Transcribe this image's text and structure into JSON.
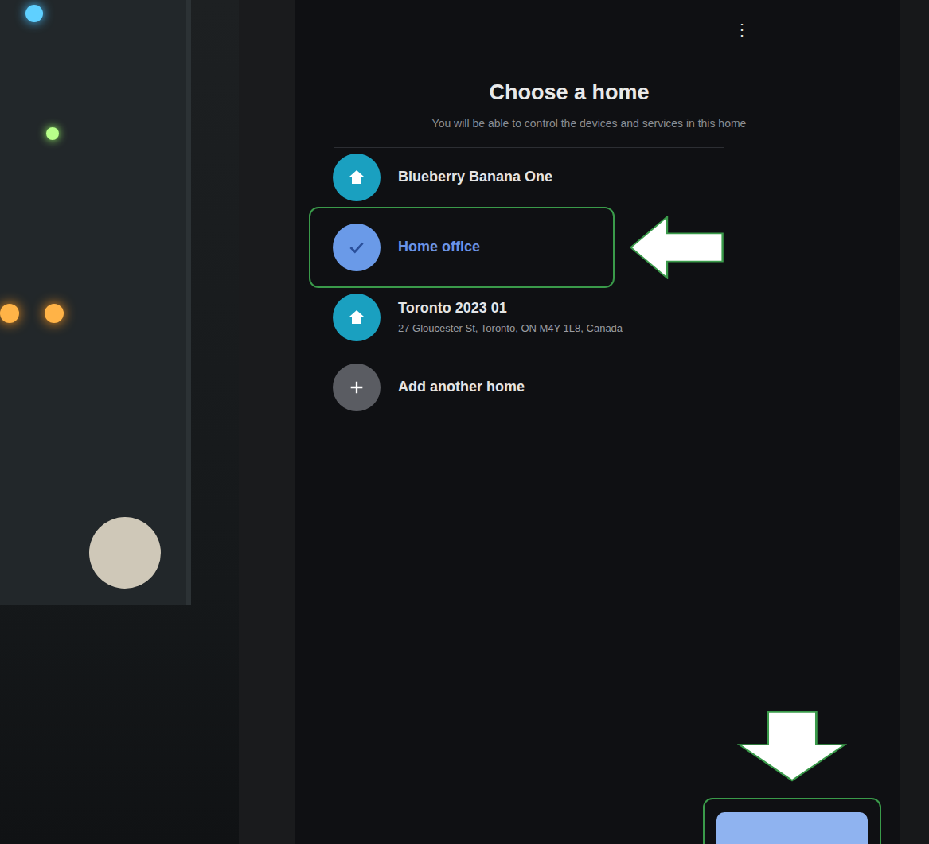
{
  "screen": {
    "menu": "⋮",
    "title": "Choose a home",
    "subtitle": "You will be able to control the devices and services in this home"
  },
  "homes": [
    {
      "name": "Blueberry Banana One",
      "address": "",
      "selected": false,
      "kind": "home"
    },
    {
      "name": "Home office",
      "address": "",
      "selected": true,
      "kind": "home"
    },
    {
      "name": "Toronto 2023 01",
      "address": "27 Gloucester St, Toronto, ON M4Y 1L8, Canada",
      "selected": false,
      "kind": "home"
    },
    {
      "name": "Add another home",
      "address": "",
      "selected": false,
      "kind": "add"
    }
  ]
}
